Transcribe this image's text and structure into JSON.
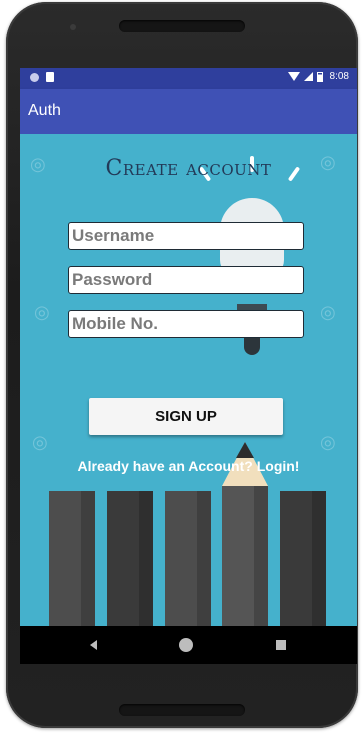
{
  "status_bar": {
    "time": "8:08"
  },
  "app_bar": {
    "title": "Auth"
  },
  "form": {
    "heading": "Create account",
    "username_placeholder": "Username",
    "password_placeholder": "Password",
    "mobile_placeholder": "Mobile No.",
    "sign_up_label": "SIGN UP",
    "login_link": "Already have an Account? Login!"
  },
  "nav_bar": {
    "back_icon": "back-triangle",
    "home_icon": "home-circle",
    "recents_icon": "recents-square"
  },
  "colors": {
    "status_bar": "#2f3f9d",
    "app_bar": "#3f51b5",
    "background": "#45b1cc",
    "title": "#233a58"
  }
}
